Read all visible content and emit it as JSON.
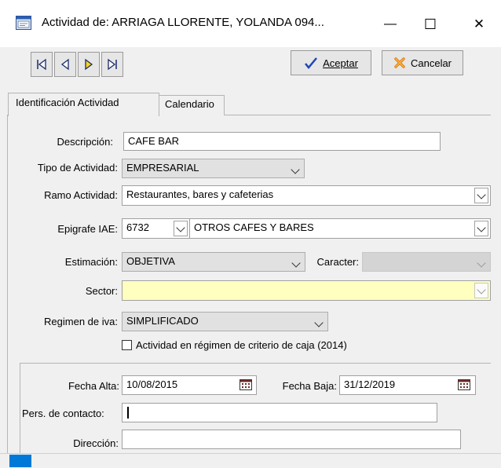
{
  "window": {
    "title": "Actividad de: ARRIAGA LLORENTE, YOLANDA 094...",
    "minimize_glyph": "—",
    "maximize_glyph": "☐",
    "close_glyph": "✕",
    "icon": "app-window-icon"
  },
  "toolbar": {
    "first_icon": "first-record-icon",
    "prev_icon": "previous-record-icon",
    "next_icon": "next-record-icon",
    "last_icon": "last-record-icon",
    "accept_label": "Aceptar",
    "cancel_label": "Cancelar"
  },
  "tabs": [
    {
      "label": "Identificación Actividad",
      "active": true
    },
    {
      "label": "Calendario",
      "active": false
    }
  ],
  "form": {
    "descripcion": {
      "label": "Descripción:",
      "value": "CAFE BAR"
    },
    "tipo_actividad": {
      "label": "Tipo de Actividad:",
      "value": "EMPRESARIAL"
    },
    "ramo_actividad": {
      "label": "Ramo Actividad:",
      "value": "Restaurantes, bares y cafeterias"
    },
    "epigrafe_iae": {
      "label": "Epigrafe IAE:",
      "code": "6732",
      "value": "OTROS CAFES Y BARES"
    },
    "estimacion": {
      "label": "Estimación:",
      "value": "OBJETIVA"
    },
    "caracter": {
      "label": "Caracter:",
      "value": ""
    },
    "sector": {
      "label": "Sector:",
      "value": ""
    },
    "regimen_iva": {
      "label": "Regimen de iva:",
      "value": "SIMPLIFICADO"
    },
    "criterio_caja": {
      "label": "Actividad en régimen de criterio de caja (2014)",
      "checked": false
    },
    "fecha_alta": {
      "label": "Fecha Alta:",
      "value": "10/08/2015"
    },
    "fecha_baja": {
      "label": "Fecha Baja:",
      "value": "31/12/2019"
    },
    "contacto": {
      "label": "Pers. de contacto:",
      "value": ""
    },
    "direccion": {
      "label": "Dirección:",
      "value": ""
    }
  },
  "colors": {
    "sector_bg": "#ffffc0",
    "accent": "#0078d7"
  }
}
